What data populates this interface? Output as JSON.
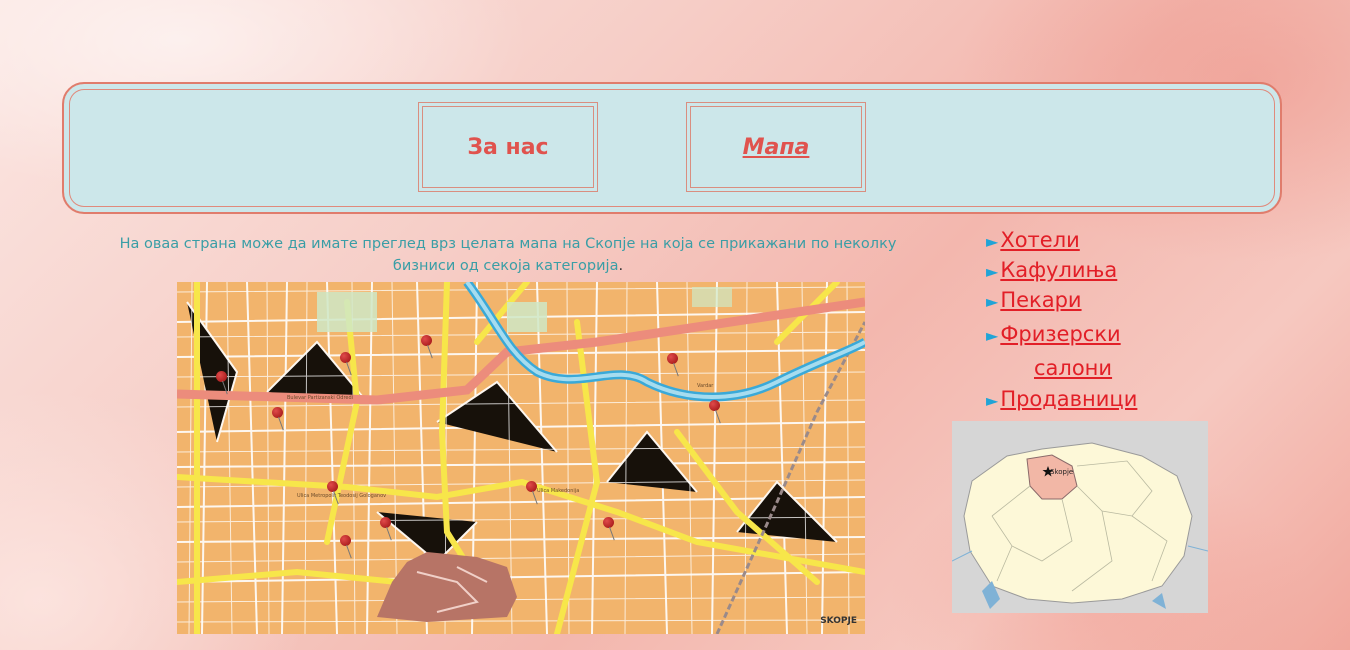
{
  "nav": {
    "about_label": "За нас",
    "map_label": "Мапа"
  },
  "intro": {
    "text": "На оваа страна може да имате преглед врз целата мапа на Скопје на која се прикажани по неколку бизниси од секоја категорија",
    "period": "."
  },
  "city_map": {
    "label": "SKOPJE",
    "pin_count": 11
  },
  "categories": {
    "hotels": "Хотели",
    "cafes": "Кафулиња ",
    "bakeries": "Пекари",
    "hair_salons_line1": "Фризерски",
    "hair_salons_line2": "салони",
    "shops": "Продавници"
  },
  "region_map": {
    "city_label": "Skopje"
  },
  "colors": {
    "accent_red": "#e21f27",
    "nav_text": "#e0534e",
    "header_bg": "#cce7ea",
    "intro_text": "#3a9ea6",
    "arrow_blue": "#21a4d6"
  }
}
